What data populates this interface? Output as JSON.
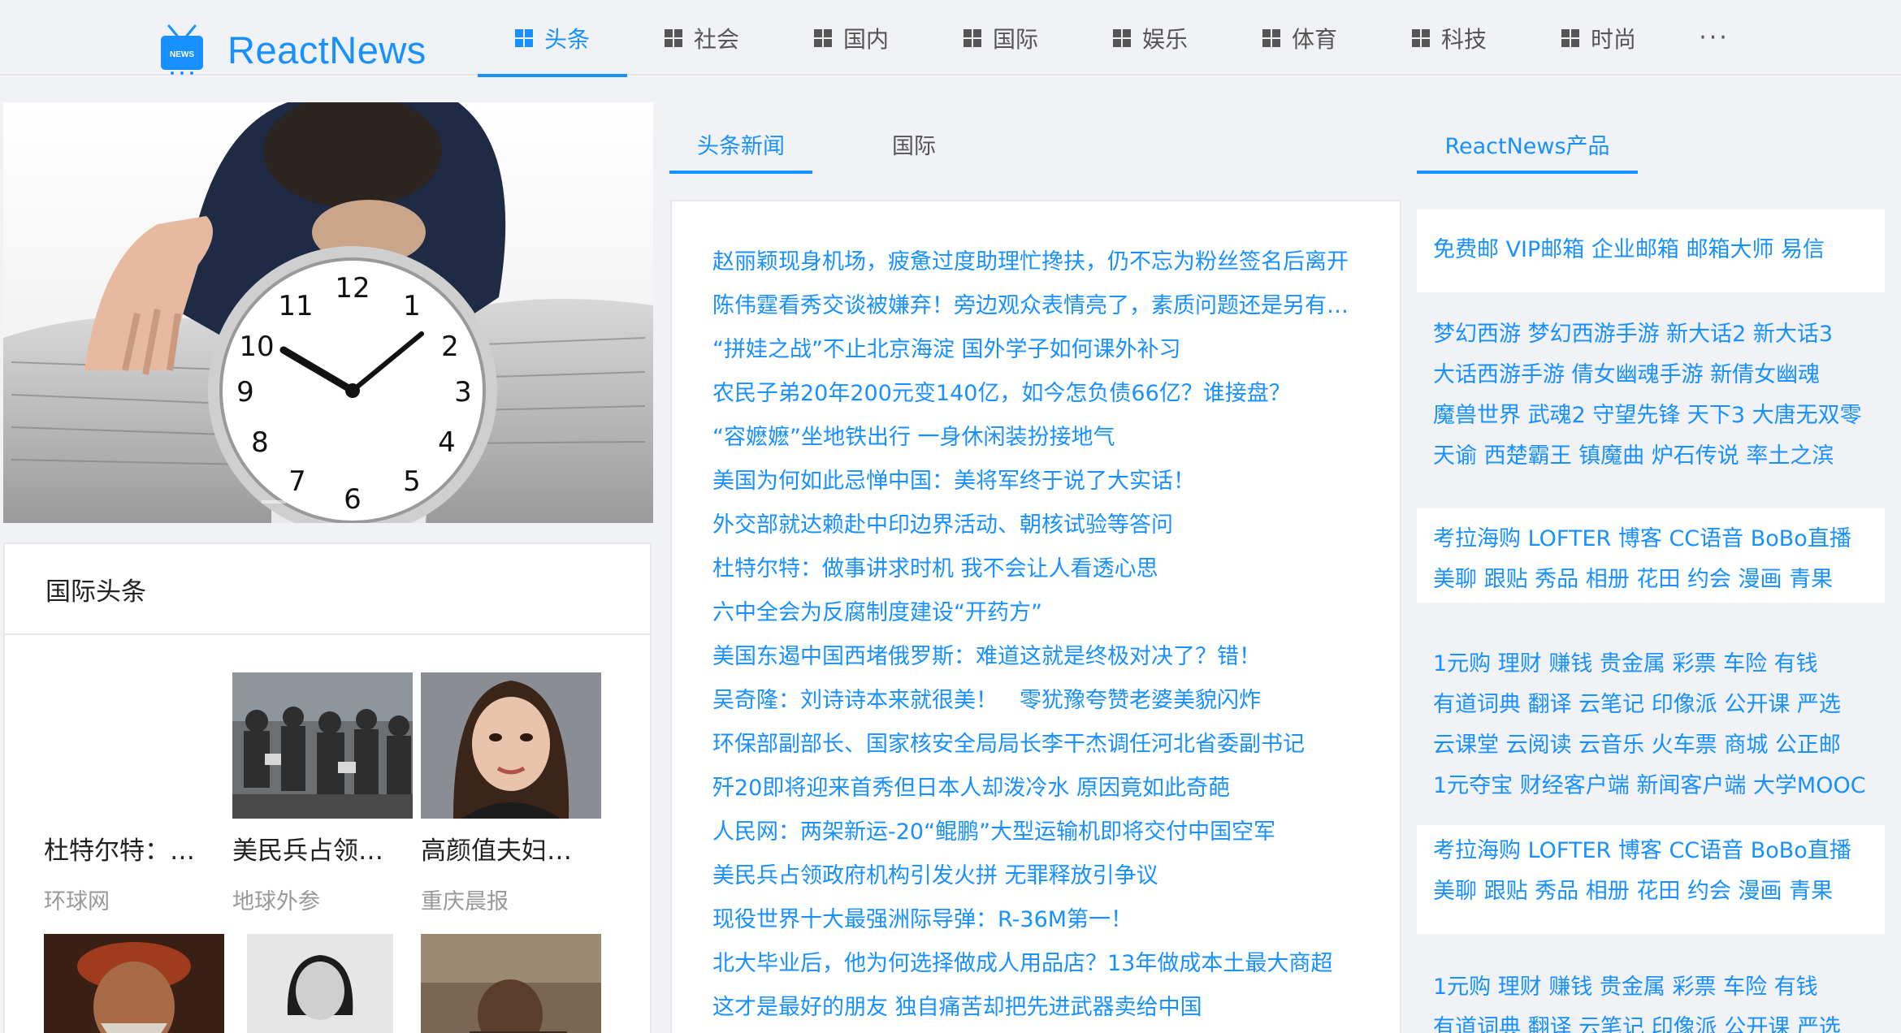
{
  "app": {
    "name": "ReactNews",
    "logo_badge": "NEWS"
  },
  "nav": {
    "items": [
      {
        "label": "头条",
        "active": true
      },
      {
        "label": "社会",
        "active": false
      },
      {
        "label": "国内",
        "active": false
      },
      {
        "label": "国际",
        "active": false
      },
      {
        "label": "娱乐",
        "active": false
      },
      {
        "label": "体育",
        "active": false
      },
      {
        "label": "科技",
        "active": false
      },
      {
        "label": "时尚",
        "active": false
      }
    ],
    "more": "···"
  },
  "carousel": {
    "slide_count": 2,
    "active_index": 1
  },
  "international": {
    "title": "国际头条",
    "cards": [
      {
        "title": "杜特尔特：…",
        "source": "环球网"
      },
      {
        "title": "美民兵占领…",
        "source": "地球外参"
      },
      {
        "title": "高颜值夫妇…",
        "source": "重庆晨报"
      }
    ]
  },
  "middle": {
    "tabs": [
      {
        "label": "头条新闻",
        "active": true
      },
      {
        "label": "国际",
        "active": false
      }
    ],
    "news": [
      "赵丽颖现身机场，疲惫过度助理忙搀扶，仍不忘为粉丝签名后离开",
      "陈伟霆看秀交谈被嫌弃！旁边观众表情亮了，素质问题还是另有…",
      "“拼娃之战”不止北京海淀 国外学子如何课外补习",
      "农民子弟20年200元变140亿，如今怎负债66亿？谁接盘？",
      "“容嬷嬷”坐地铁出行 一身休闲装扮接地气",
      "美国为何如此忌惮中国：美将军终于说了大实话！",
      "外交部就达赖赴中印边界活动、朝核试验等答问",
      "杜特尔特：做事讲求时机 我不会让人看透心思",
      "六中全会为反腐制度建设“开药方”",
      "美国东遏中国西堵俄罗斯：难道这就是终极对决了？错！",
      "吴奇隆：刘诗诗本来就很美！　零犹豫夸赞老婆美貌闪炸",
      "环保部副部长、国家核安全局局长李干杰调任河北省委副书记",
      "歼20即将迎来首秀但日本人却泼冷水 原因竟如此奇葩",
      "人民网：两架新运-20“鲲鹏”大型运输机即将交付中国空军",
      "美民兵占领政府机构引发火拼 无罪释放引争议",
      "现役世界十大最强洲际导弹：R-36M第一！",
      "北大毕业后，他为何选择做成人用品店？13年做成本土最大商超",
      "这才是最好的朋友 独自痛苦却把先进武器卖给中国"
    ]
  },
  "products": {
    "tab_label": "ReactNews产品",
    "groups": [
      [
        "免费邮  VIP邮箱  企业邮箱  邮箱大师  易信"
      ],
      [
        "梦幻西游  梦幻西游手游  新大话2  新大话3",
        "大话西游手游  倩女幽魂手游 新倩女幽魂",
        "魔兽世界 武魂2 守望先锋 天下3 大唐无双零",
        "天谕  西楚霸王 镇魔曲  炉石传说  率土之滨"
      ],
      [
        "考拉海购 LOFTER 博客 CC语音 BoBo直播",
        "美聊 跟贴 秀品 相册 花田 约会 漫画 青果"
      ],
      [
        "1元购  理财  赚钱  贵金属  彩票 车险 有钱",
        "有道词典  翻译  云笔记 印像派 公开课  严选",
        "云课堂  云阅读  云音乐  火车票 商城  公正邮",
        "1元夺宝  财经客户端 新闻客户端 大学MOOC"
      ],
      [
        "考拉海购 LOFTER 博客 CC语音 BoBo直播",
        "美聊 跟贴 秀品 相册 花田 约会 漫画 青果"
      ],
      [
        "1元购  理财  赚钱  贵金属  彩票 车险 有钱",
        "有道词典  翻译  云笔记 印像派 公开课  严选"
      ]
    ]
  },
  "colors": {
    "accent": "#1890ff",
    "background": "#f0f2f5"
  },
  "icons": {
    "nav": "grid-icon",
    "logo": "tv-icon"
  }
}
